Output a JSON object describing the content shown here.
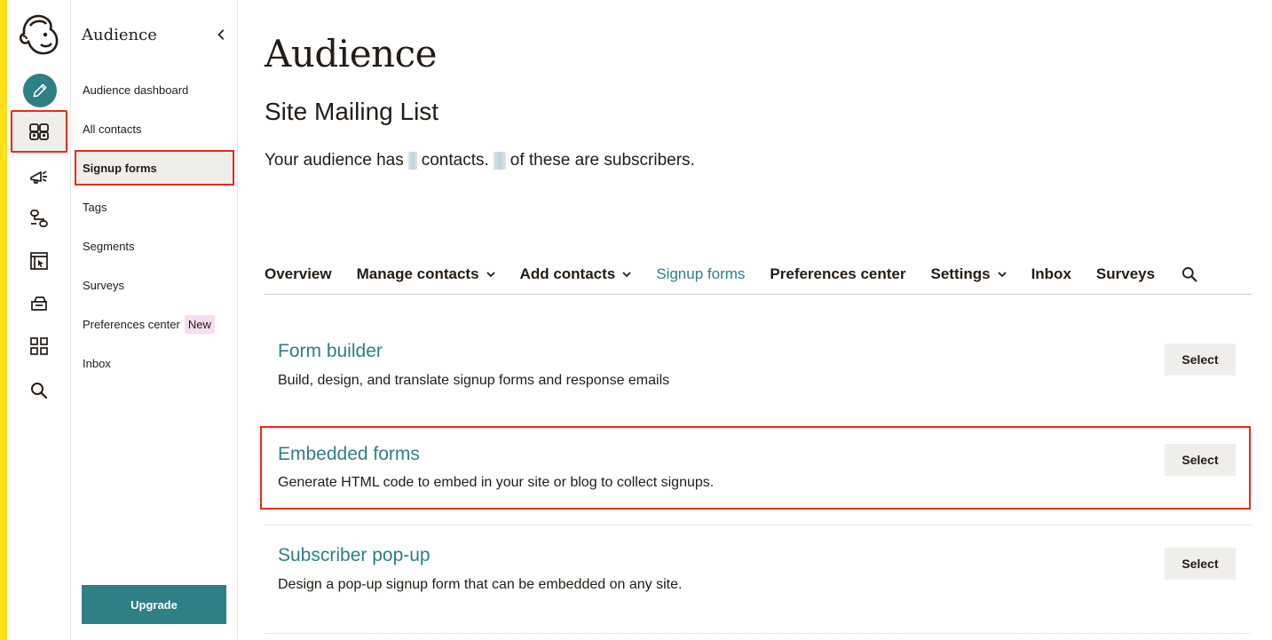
{
  "brand": {
    "accent": "#2f7f86",
    "highlight": "#e02e1a",
    "strip": "#ffe01b"
  },
  "rail": {
    "items": [
      {
        "icon": "mailchimp-logo-icon"
      },
      {
        "icon": "pencil-icon",
        "label": "Create"
      },
      {
        "icon": "audience-icon",
        "label": "Audience"
      },
      {
        "icon": "megaphone-icon",
        "label": "Campaigns"
      },
      {
        "icon": "automations-icon",
        "label": "Automations"
      },
      {
        "icon": "website-icon",
        "label": "Website"
      },
      {
        "icon": "content-studio-icon",
        "label": "Content"
      },
      {
        "icon": "integrations-grid-icon",
        "label": "Integrations"
      },
      {
        "icon": "search-icon",
        "label": "Search"
      }
    ]
  },
  "subnav": {
    "title": "Audience",
    "items": [
      {
        "label": "Audience dashboard"
      },
      {
        "label": "All contacts"
      },
      {
        "label": "Signup forms",
        "selected": true
      },
      {
        "label": "Tags"
      },
      {
        "label": "Segments"
      },
      {
        "label": "Surveys"
      },
      {
        "label": "Preferences center",
        "badge": "New"
      },
      {
        "label": "Inbox"
      }
    ],
    "upgrade_label": "Upgrade"
  },
  "main": {
    "title": "Audience",
    "list_name": "Site Mailing List",
    "summary_part1": "Your audience has",
    "summary_part2": "contacts.",
    "summary_part3": "of these are subscribers.",
    "tabs": [
      {
        "label": "Overview"
      },
      {
        "label": "Manage contacts",
        "dropdown": true
      },
      {
        "label": "Add contacts",
        "dropdown": true
      },
      {
        "label": "Signup forms",
        "active": true
      },
      {
        "label": "Preferences center"
      },
      {
        "label": "Settings",
        "dropdown": true
      },
      {
        "label": "Inbox"
      },
      {
        "label": "Surveys"
      }
    ],
    "options": [
      {
        "title": "Form builder",
        "description": "Build, design, and translate signup forms and response emails",
        "button": "Select"
      },
      {
        "title": "Embedded forms",
        "description": "Generate HTML code to embed in your site or blog to collect signups.",
        "button": "Select"
      },
      {
        "title": "Subscriber pop-up",
        "description": "Design a pop-up signup form that can be embedded on any site.",
        "button": "Select"
      }
    ]
  }
}
